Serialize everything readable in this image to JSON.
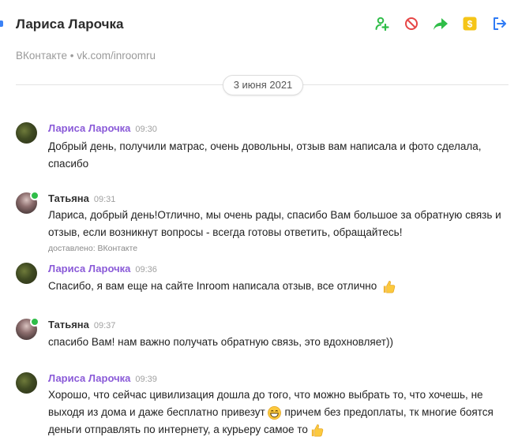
{
  "header": {
    "title": "Лариса Ларочка",
    "subtitle": "ВКонтакте • vk.com/inroomru",
    "actions": [
      {
        "icon": "add-user-icon",
        "color": "#2fbd48"
      },
      {
        "icon": "block-icon",
        "color": "#e64646"
      },
      {
        "icon": "forward-icon",
        "color": "#2fbd48"
      },
      {
        "icon": "dollar-icon",
        "color": "#f5c518"
      },
      {
        "icon": "logout-icon",
        "color": "#2f7bf5"
      }
    ]
  },
  "date_separator": "3 июня 2021",
  "messages": [
    {
      "author": "Лариса Ларочка",
      "time": "09:30",
      "text": "Добрый день, получили матрас, очень довольны, отзыв вам написала и фото сделала, спасибо"
    },
    {
      "author": "Татьяна",
      "time": "09:31",
      "text": "Лариса, добрый день!Отлично, мы очень рады, спасибо Вам большое за обратную связь и отзыв, если возникнут вопросы - всегда готовы ответить, обращайтесь!",
      "delivered": "доставлено: ВКонтакте"
    },
    {
      "author": "Лариса Ларочка",
      "time": "09:36",
      "text": "Спасибо, я вам еще на сайте Inroom написала отзыв, все отлично"
    },
    {
      "author": "Татьяна",
      "time": "09:37",
      "text": "спасибо Вам! нам важно получать обратную связь, это вдохновляет))"
    },
    {
      "author": "Лариса Ларочка",
      "time": "09:39",
      "text_part1": "Хорошо, что сейчас цивилизация дошла до того, что можно выбрать то, что хочешь, не выходя из дома и даже бесплатно привезут",
      "text_part2": " причем без предоплаты, тк многие боятся деньги отправлять по интернету, а курьеру самое то"
    }
  ]
}
